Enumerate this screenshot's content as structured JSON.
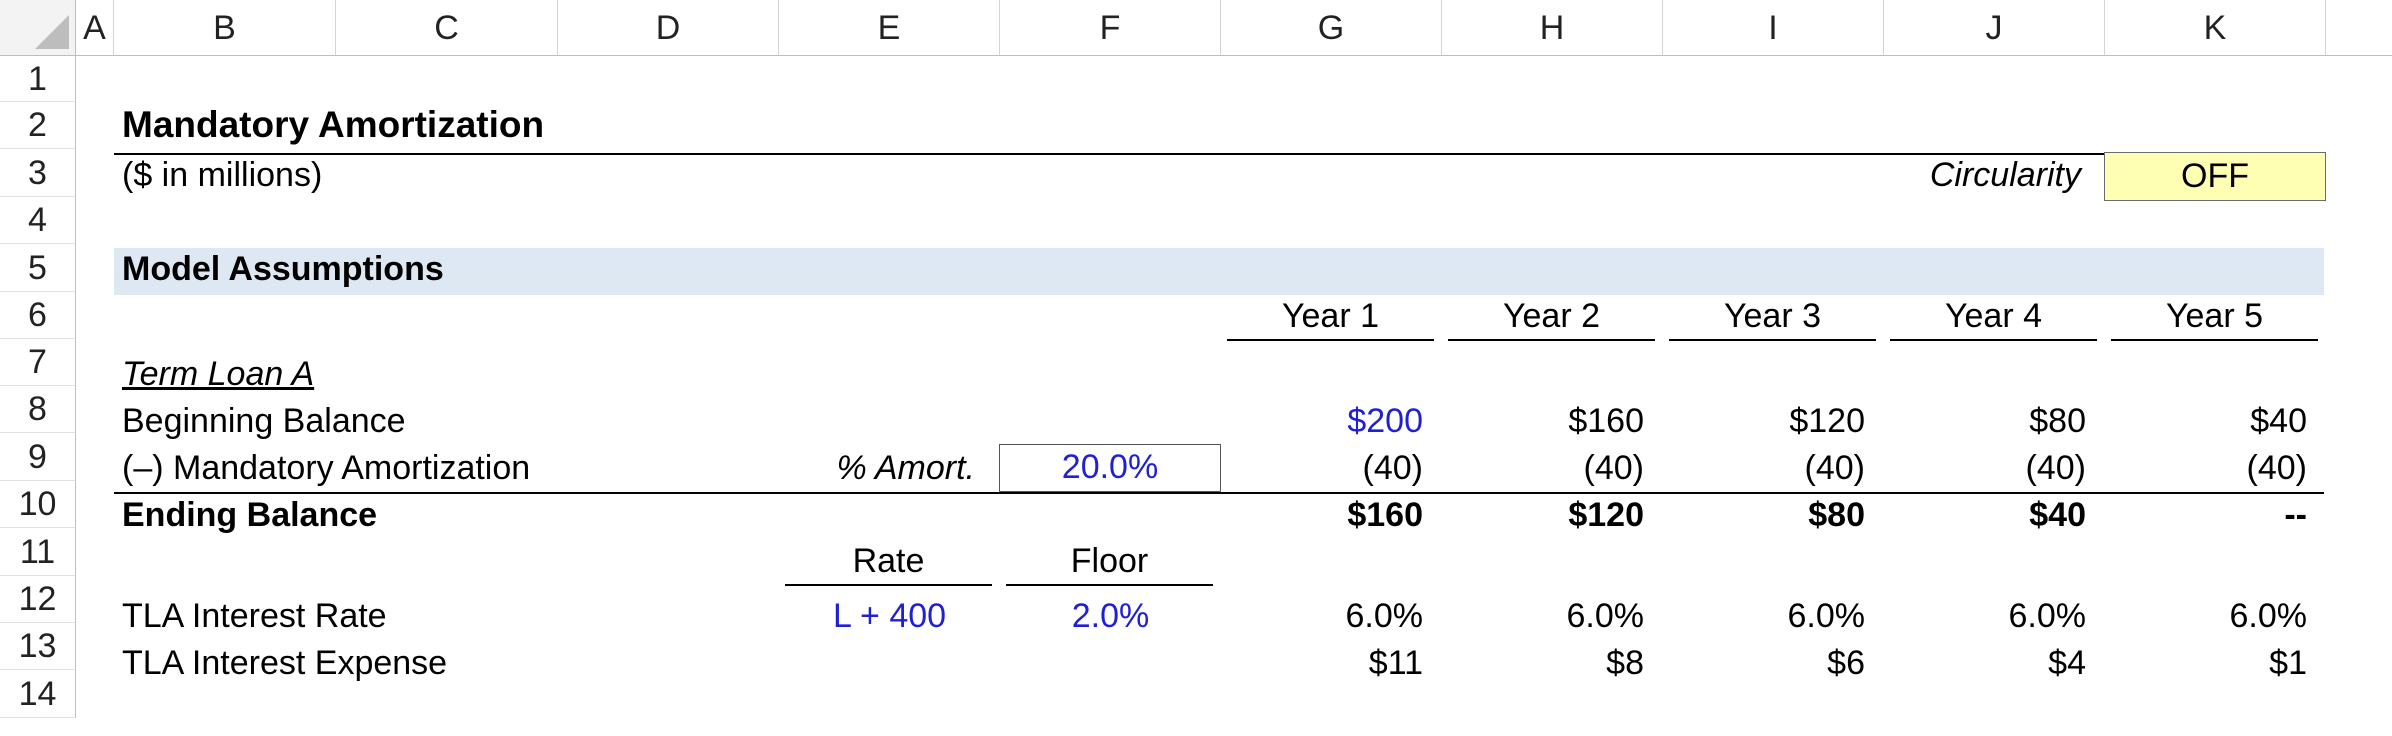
{
  "columns": [
    "A",
    "B",
    "C",
    "D",
    "E",
    "F",
    "G",
    "H",
    "I",
    "J",
    "K"
  ],
  "rows": [
    "1",
    "2",
    "3",
    "4",
    "5",
    "6",
    "7",
    "8",
    "9",
    "10",
    "11",
    "12",
    "13",
    "14"
  ],
  "title": "Mandatory Amortization",
  "units": "($ in millions)",
  "circularity": {
    "label": "Circularity",
    "value": "OFF"
  },
  "section": "Model Assumptions",
  "years": [
    "Year 1",
    "Year 2",
    "Year 3",
    "Year 4",
    "Year 5"
  ],
  "term_loan_label": "Term Loan A",
  "beginning_balance": {
    "label": "Beginning Balance",
    "values": [
      "$200",
      "$160",
      "$120",
      "$80",
      "$40"
    ]
  },
  "amortization": {
    "label": "(–) Mandatory Amortization",
    "pct_label": "% Amort.",
    "pct_value": "20.0%",
    "values": [
      "(40)",
      "(40)",
      "(40)",
      "(40)",
      "(40)"
    ]
  },
  "ending_balance": {
    "label": "Ending Balance",
    "values": [
      "$160",
      "$120",
      "$80",
      "$40",
      "--"
    ]
  },
  "rate_header": "Rate",
  "floor_header": "Floor",
  "interest_rate": {
    "label": "TLA Interest Rate",
    "rate": "L + 400",
    "floor": "2.0%",
    "values": [
      "6.0%",
      "6.0%",
      "6.0%",
      "6.0%",
      "6.0%"
    ]
  },
  "interest_expense": {
    "label": "TLA Interest Expense",
    "values": [
      "$11",
      "$8",
      "$6",
      "$4",
      "$1"
    ]
  },
  "colors": {
    "input_blue": "#1f1fd6",
    "band": "#dde8f3",
    "toggle": "#ffffb3"
  }
}
